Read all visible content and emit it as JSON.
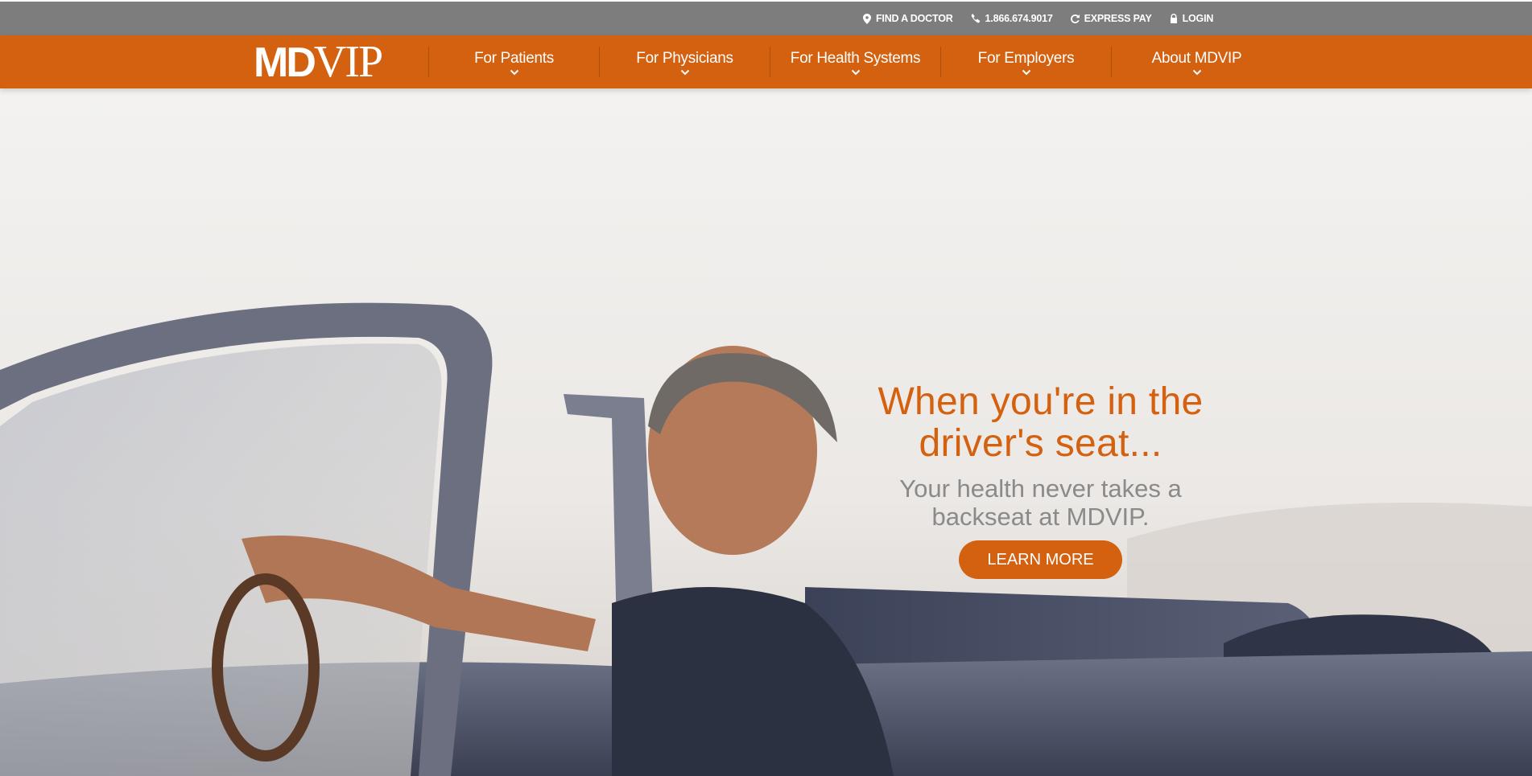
{
  "utility_bar": {
    "find_doctor": "FIND A DOCTOR",
    "phone": "1.866.674.9017",
    "express_pay": "EXPRESS PAY",
    "login": "LOGIN"
  },
  "brand": {
    "logo_md": "MD",
    "logo_vip": "VIP"
  },
  "nav": {
    "items": [
      {
        "label": "For Patients"
      },
      {
        "label": "For Physicians"
      },
      {
        "label": "For Health Systems"
      },
      {
        "label": "For Employers"
      },
      {
        "label": "About MDVIP"
      }
    ]
  },
  "hero": {
    "headline_line1": "When you're in the",
    "headline_line2": "driver's seat...",
    "sub_line1": "Your health never takes a",
    "sub_line2": "backseat at MDVIP.",
    "cta": "LEARN MORE"
  },
  "colors": {
    "accent": "#d3610f",
    "utility_bar": "#7d7d7d",
    "subtext": "#8a8a8a"
  },
  "icons": {
    "find_doctor": "map-pin-icon",
    "phone": "phone-icon",
    "express_pay": "refresh-dollar-icon",
    "login": "lock-icon",
    "nav_dropdown": "chevron-down-icon"
  }
}
